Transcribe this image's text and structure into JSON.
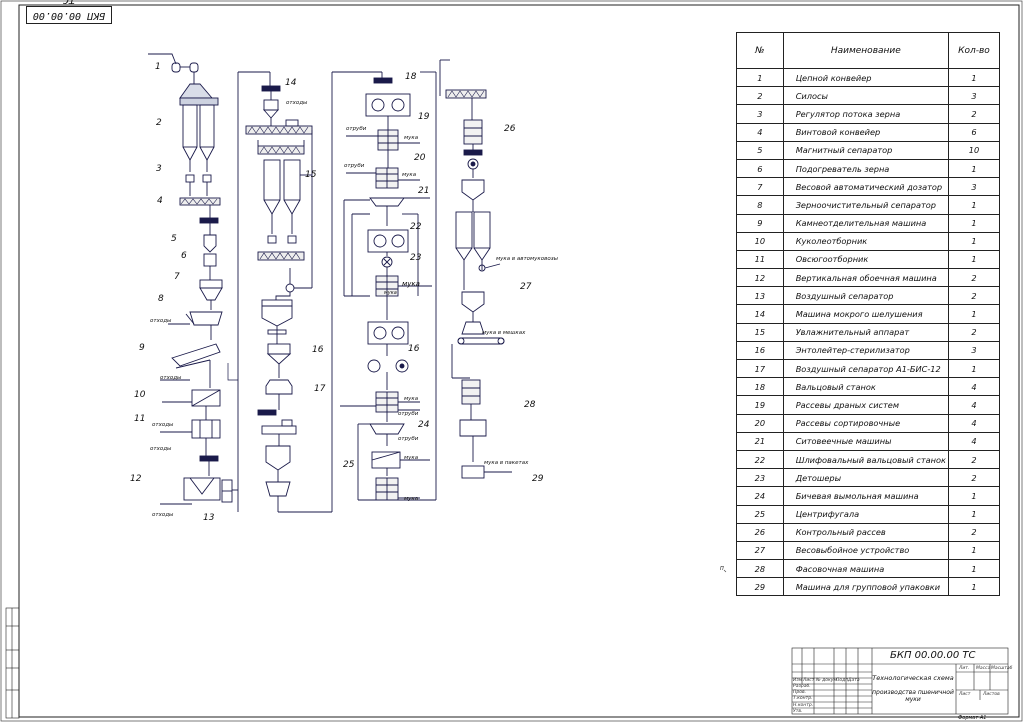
{
  "drawing": {
    "code_mirrored": "БКП 00.00.00 ТС",
    "format_label": "Формат А1",
    "mark": "П"
  },
  "legend": {
    "headers": {
      "num": "№",
      "name": "Наименование",
      "qty": "Кол-во"
    },
    "rows": [
      {
        "num": "1",
        "name": "Цепной конвейер",
        "qty": "1"
      },
      {
        "num": "2",
        "name": "Силосы",
        "qty": "3"
      },
      {
        "num": "3",
        "name": "Регулятор потока зерна",
        "qty": "2"
      },
      {
        "num": "4",
        "name": "Винтовой конвейер",
        "qty": "6"
      },
      {
        "num": "5",
        "name": "Магнитный сепаратор",
        "qty": "10"
      },
      {
        "num": "6",
        "name": "Подогреватель зерна",
        "qty": "1"
      },
      {
        "num": "7",
        "name": "Весовой автоматический дозатор",
        "qty": "3"
      },
      {
        "num": "8",
        "name": "Зерноочистительный сепаратор",
        "qty": "1"
      },
      {
        "num": "9",
        "name": "Камнеотделительная машина",
        "qty": "1"
      },
      {
        "num": "10",
        "name": "Куколеотборник",
        "qty": "1"
      },
      {
        "num": "11",
        "name": "Овсюгоотборник",
        "qty": "1"
      },
      {
        "num": "12",
        "name": "Вертикальная обоечная машина",
        "qty": "2"
      },
      {
        "num": "13",
        "name": "Воздушный сепаратор",
        "qty": "2"
      },
      {
        "num": "14",
        "name": "Машина мокрого шелушения",
        "qty": "1"
      },
      {
        "num": "15",
        "name": "Увлажнительный аппарат",
        "qty": "2"
      },
      {
        "num": "16",
        "name": "Энтолейтер-стерилизатор",
        "qty": "3"
      },
      {
        "num": "17",
        "name": "Воздушный сепаратор А1-БИС-12",
        "qty": "1"
      },
      {
        "num": "18",
        "name": "Вальцовый станок",
        "qty": "4"
      },
      {
        "num": "19",
        "name": "Рассевы драных систем",
        "qty": "4"
      },
      {
        "num": "20",
        "name": "Рассевы сортировочные",
        "qty": "4"
      },
      {
        "num": "21",
        "name": "Ситовеечные машины",
        "qty": "4"
      },
      {
        "num": "22",
        "name": "Шлифовальный вальцовый станок",
        "qty": "2"
      },
      {
        "num": "23",
        "name": "Детошеры",
        "qty": "2"
      },
      {
        "num": "24",
        "name": "Бичевая вымольная машина",
        "qty": "1"
      },
      {
        "num": "25",
        "name": "Центрифугала",
        "qty": "1"
      },
      {
        "num": "26",
        "name": "Контрольный рассев",
        "qty": "2"
      },
      {
        "num": "27",
        "name": "Весовыбойное устройство",
        "qty": "1"
      },
      {
        "num": "28",
        "name": "Фасовочная машина",
        "qty": "1"
      },
      {
        "num": "29",
        "name": "Машина для групповой упаковки",
        "qty": "1"
      }
    ]
  },
  "title_block": {
    "code": "БКП 00.00.00 ТС",
    "name": "Технологическая схема",
    "subtitle": "производства пшеничной муки",
    "cells": {
      "izm": "Изм",
      "list": "Лист",
      "ndok": "№ докум.",
      "podp": "Подп.",
      "data": "Дата",
      "razrab": "Разраб.",
      "prov": "Пров.",
      "tkontr": "Т.контр.",
      "nkontr": "Н.контр.",
      "utv": "Утв.",
      "lit": "Лит.",
      "massa": "Масса",
      "masshtab": "Масштаб",
      "sheet": "Лист",
      "sheets": "Листов"
    }
  },
  "diagram": {
    "labels": {
      "n1": "1",
      "n2": "2",
      "n3": "3",
      "n4": "4",
      "n5": "5",
      "n6": "6",
      "n7": "7",
      "n8": "8",
      "n9": "9",
      "n10": "10",
      "n11": "11",
      "n12": "12",
      "n13": "13",
      "n14": "14",
      "n15": "15",
      "n16a": "16",
      "n16b": "16",
      "n17": "17",
      "n18": "18",
      "n19": "19",
      "n20": "20",
      "n21": "21",
      "n22": "22",
      "n23": "23",
      "n24": "24",
      "n25": "25",
      "n26": "26",
      "n27": "27",
      "n28": "28",
      "n29": "29"
    },
    "texts": {
      "otkhody1": "отходы",
      "otkhody2": "отходы",
      "otkhody3": "отходы",
      "otkhody4": "отходы",
      "otkhody5": "отходы",
      "otkhody6": "отходы",
      "otrubi1": "отруби",
      "otrubi2": "отруби",
      "otrubi3": "отруби",
      "otrubi4": "отруби",
      "muka1": "мука",
      "muka2": "мука",
      "muka3": "мука",
      "muka4": "мука",
      "muka5": "мука",
      "muka6": "мука",
      "muka7": "мука",
      "muka_auto": "мука в автомуковозы",
      "muka_meshok": "мука в мешках",
      "muka_paket": "мука в пакетах"
    }
  }
}
